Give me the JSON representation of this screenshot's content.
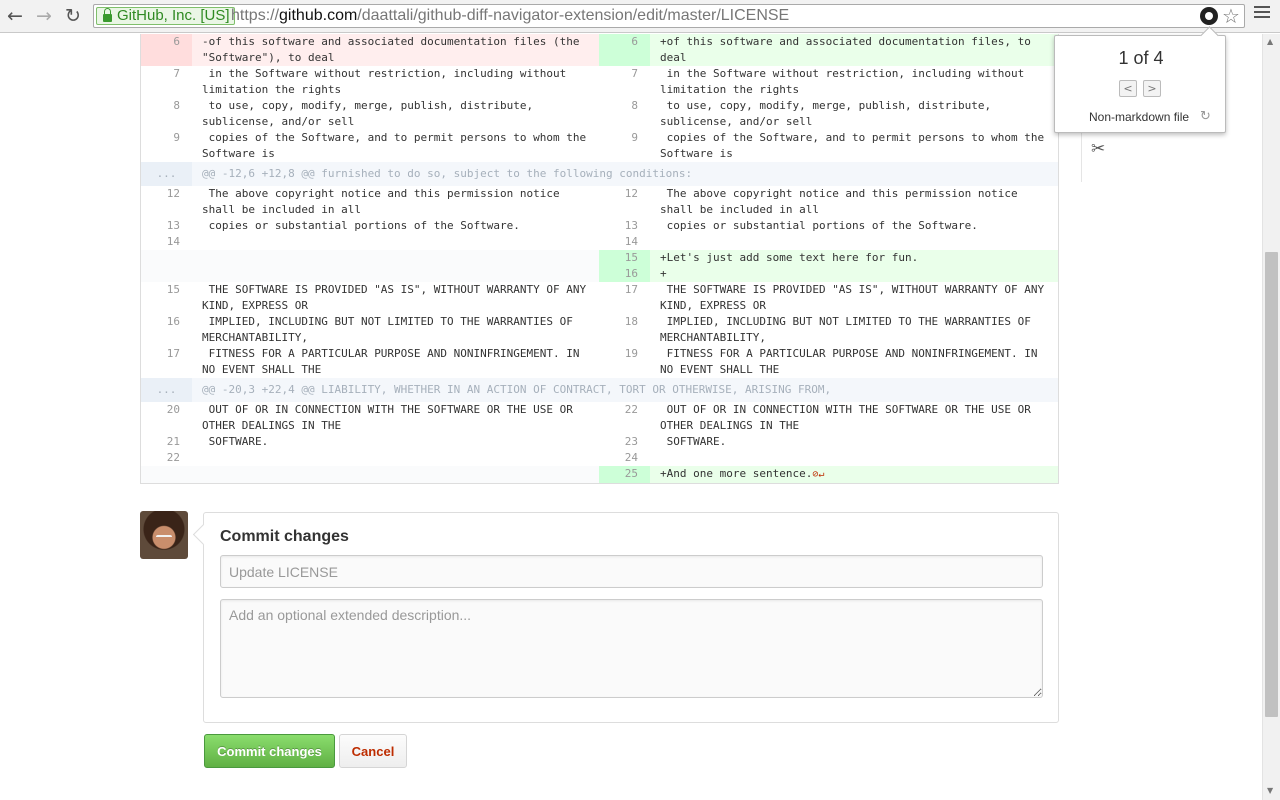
{
  "browser": {
    "ev_label": "GitHub, Inc. [US]",
    "url_prefix": "https://",
    "url_host": "github.com",
    "url_path": "/daattali/github-diff-navigator-extension/edit/master/LICENSE"
  },
  "popup": {
    "count": "1 of 4",
    "prev_symbol": "<",
    "next_symbol": ">",
    "file_type": "Non-markdown file"
  },
  "diff": {
    "rows": [
      {
        "left": {
          "num": "6",
          "text": "-of this software and associated documentation files (the \"Software\"), to deal",
          "type": "del"
        },
        "right": {
          "num": "6",
          "text": "+of this software and associated documentation files, to deal",
          "type": "add"
        }
      },
      {
        "left": {
          "num": "7",
          "text": " in the Software without restriction, including without limitation the rights",
          "type": "ctx"
        },
        "right": {
          "num": "7",
          "text": " in the Software without restriction, including without limitation the rights",
          "type": "ctx"
        }
      },
      {
        "left": {
          "num": "8",
          "text": " to use, copy, modify, merge, publish, distribute, sublicense, and/or sell",
          "type": "ctx"
        },
        "right": {
          "num": "8",
          "text": " to use, copy, modify, merge, publish, distribute, sublicense, and/or sell",
          "type": "ctx"
        }
      },
      {
        "left": {
          "num": "9",
          "text": " copies of the Software, and to permit persons to whom the Software is",
          "type": "ctx"
        },
        "right": {
          "num": "9",
          "text": " copies of the Software, and to permit persons to whom the Software is",
          "type": "ctx"
        }
      }
    ],
    "hunk1": "@@ -12,6 +12,8 @@ furnished to do so, subject to the following conditions:",
    "rows2": [
      {
        "left": {
          "num": "12",
          "text": " The above copyright notice and this permission notice shall be included in all",
          "type": "ctx"
        },
        "right": {
          "num": "12",
          "text": " The above copyright notice and this permission notice shall be included in all",
          "type": "ctx"
        }
      },
      {
        "left": {
          "num": "13",
          "text": " copies or substantial portions of the Software.",
          "type": "ctx"
        },
        "right": {
          "num": "13",
          "text": " copies or substantial portions of the Software.",
          "type": "ctx"
        }
      },
      {
        "left": {
          "num": "14",
          "text": "",
          "type": "ctx"
        },
        "right": {
          "num": "14",
          "text": "",
          "type": "ctx"
        }
      },
      {
        "left": {
          "num": "",
          "text": "",
          "type": "empty"
        },
        "right": {
          "num": "15",
          "text": "+Let's just add some text here for fun.",
          "type": "add"
        }
      },
      {
        "left": {
          "num": "",
          "text": "",
          "type": "empty"
        },
        "right": {
          "num": "16",
          "text": "+",
          "type": "add"
        }
      },
      {
        "left": {
          "num": "15",
          "text": " THE SOFTWARE IS PROVIDED \"AS IS\", WITHOUT WARRANTY OF ANY KIND, EXPRESS OR",
          "type": "ctx"
        },
        "right": {
          "num": "17",
          "text": " THE SOFTWARE IS PROVIDED \"AS IS\", WITHOUT WARRANTY OF ANY KIND, EXPRESS OR",
          "type": "ctx"
        }
      },
      {
        "left": {
          "num": "16",
          "text": " IMPLIED, INCLUDING BUT NOT LIMITED TO THE WARRANTIES OF MERCHANTABILITY,",
          "type": "ctx"
        },
        "right": {
          "num": "18",
          "text": " IMPLIED, INCLUDING BUT NOT LIMITED TO THE WARRANTIES OF MERCHANTABILITY,",
          "type": "ctx"
        }
      },
      {
        "left": {
          "num": "17",
          "text": " FITNESS FOR A PARTICULAR PURPOSE AND NONINFRINGEMENT. IN NO EVENT SHALL THE",
          "type": "ctx"
        },
        "right": {
          "num": "19",
          "text": " FITNESS FOR A PARTICULAR PURPOSE AND NONINFRINGEMENT. IN NO EVENT SHALL THE",
          "type": "ctx"
        }
      }
    ],
    "hunk2": "@@ -20,3 +22,4 @@ LIABILITY, WHETHER IN AN ACTION OF CONTRACT, TORT OR OTHERWISE, ARISING FROM,",
    "rows3": [
      {
        "left": {
          "num": "20",
          "text": " OUT OF OR IN CONNECTION WITH THE SOFTWARE OR THE USE OR OTHER DEALINGS IN THE",
          "type": "ctx"
        },
        "right": {
          "num": "22",
          "text": " OUT OF OR IN CONNECTION WITH THE SOFTWARE OR THE USE OR OTHER DEALINGS IN THE",
          "type": "ctx"
        }
      },
      {
        "left": {
          "num": "21",
          "text": " SOFTWARE.",
          "type": "ctx"
        },
        "right": {
          "num": "23",
          "text": " SOFTWARE.",
          "type": "ctx"
        }
      },
      {
        "left": {
          "num": "22",
          "text": "",
          "type": "ctx"
        },
        "right": {
          "num": "24",
          "text": "",
          "type": "ctx"
        }
      },
      {
        "left": {
          "num": "",
          "text": "",
          "type": "empty"
        },
        "right": {
          "num": "25",
          "text": "+And one more sentence.",
          "type": "add",
          "noeol": "⊘↵"
        }
      }
    ],
    "hunk_marker": "..."
  },
  "commit": {
    "title": "Commit changes",
    "summary_placeholder": "Update LICENSE",
    "desc_placeholder": "Add an optional extended description...",
    "commit_label": "Commit changes",
    "cancel_label": "Cancel"
  }
}
